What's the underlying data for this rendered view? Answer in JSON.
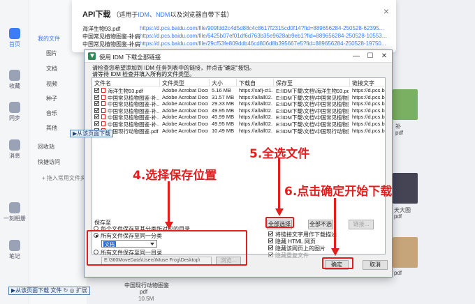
{
  "api_panel": {
    "title": "API下载",
    "subtitle_prefix": "（适用于",
    "idm": "IDM",
    "sep": "、",
    "ndm": "NDM",
    "subtitle_suffix": "以及浏览器自带下载）",
    "close": "×",
    "rows": [
      {
        "name": "海洋生物93.pdf",
        "url": "https://d.pcs.baidu.com/file/909fdd2c4d5d88c4c8617f2315cd0f14?fid=889656284-250528-62395..."
      },
      {
        "name": "中国常见植物图鉴-补病菌...",
        "url": "https://d.pcs.baidu.com/file/6425b07ef01df6d763b35e9628ab9eb1?fid=889656284-250528-10553..."
      },
      {
        "name": "中国常见植物图鉴-补病菌...",
        "url": "https://d.pcs.baidu.com/file/29cf53fe809ddb46cd806d8b395667e5?fid=889656284-250528-19750..."
      }
    ]
  },
  "bg": {
    "nav": [
      {
        "label": "首页",
        "active": true
      },
      {
        "label": "收藏"
      },
      {
        "label": "同步"
      },
      {
        "label": "消息"
      },
      {
        "label": "一刻相册"
      },
      {
        "label": "笔记"
      }
    ],
    "side_items": [
      {
        "label": "我的文件",
        "blue": true
      },
      {
        "label": "图片"
      },
      {
        "label": "文档"
      },
      {
        "label": "视频"
      },
      {
        "label": "种子"
      },
      {
        "label": "音乐"
      },
      {
        "label": "其他"
      },
      {
        "label": "回收站"
      },
      {
        "label": "快捷访问"
      },
      {
        "label": "+ 拖入常用文件夹"
      }
    ],
    "file_labels": [
      "补",
      "pdf",
      "...",
      "天大图",
      "pdf",
      "pdf"
    ],
    "bottom_file": {
      "name": "中国现行动物图鉴",
      "type": "pdf",
      "size": "10.5M"
    },
    "strip_bottom": "▶从该页面下载 文件",
    "strip_bottom_extra": "↻ ◎ 扩展",
    "strip_mid": "▶从该页面下载"
  },
  "dialog": {
    "title": "使用 IDM 下载全部链接",
    "desc_line1": "请检查您希望添加到 IDM 任务列表中的链接，并点击\"确定\"按钮。",
    "desc_line2": "请等待 IDM 检查并填入所有的文件类型。",
    "columns": [
      "文件名",
      "文件类型",
      "大小",
      "下载自",
      "保存至",
      "链接文字"
    ],
    "rows": [
      {
        "name": "海洋生物93.pdf",
        "type": "Adobe Acrobat Docu...",
        "size": "5.16 MB",
        "from": "https://xafj-ct1...",
        "save": "E:\\IDM下载\\文档\\海洋生物93.pdf",
        "link": "https://d.pcs.b..."
      },
      {
        "name": "中国常见植物图鉴-补...",
        "type": "Adobe Acrobat Docu...",
        "size": "31.57 MB",
        "from": "https://allall02...",
        "save": "E:\\IDM下载\\文档\\中国常见植物图鉴...",
        "link": "https://d.pcs.b..."
      },
      {
        "name": "中国常见植物图鉴-补...",
        "type": "Adobe Acrobat Docu...",
        "size": "29.33 MB",
        "from": "https://allall02...",
        "save": "E:\\IDM下载\\文档\\中国常见植物图鉴...",
        "link": "https://d.pcs.b..."
      },
      {
        "name": "中国常见植物图鉴-补...",
        "type": "Adobe Acrobat Docu...",
        "size": "49.95 MB",
        "from": "https://allall02...",
        "save": "E:\\IDM下载\\文档\\中国常见植物图鉴...",
        "link": "https://d.pcs.b..."
      },
      {
        "name": "中国常见植物图鉴-补...",
        "type": "Adobe Acrobat Docu...",
        "size": "45.99 MB",
        "from": "https://allall02...",
        "save": "E:\\IDM下载\\文档\\中国常见植物图鉴...",
        "link": "https://d.pcs.b..."
      },
      {
        "name": "中国常见植物图鉴-补...",
        "type": "Adobe Acrobat Docu...",
        "size": "49.95 MB",
        "from": "https://allall02...",
        "save": "E:\\IDM下载\\文档\\中国常见植物图鉴...",
        "link": "https://d.pcs.b..."
      },
      {
        "name": "中国现行动物图鉴.pdf",
        "type": "Adobe Acrobat Docu...",
        "size": "10.49 MB",
        "from": "https://allall02...",
        "save": "E:\\IDM下载\\文档\\中国现行动物图鉴...",
        "link": "https://d.pcs.b..."
      }
    ],
    "save_group_label": "保存至",
    "opt1": "每个文件保存至其分类所对应的目录",
    "opt2": "所有文件保存至同一分类",
    "category_value": "文档",
    "opt3": "所有文件保存至同一目录",
    "path_value": "E:\\360MoveData\\Users\\Muse Frog\\Desktop\\",
    "browse": "浏览...",
    "select_all": "全部选择",
    "select_none": "全部不选",
    "link_text_btn": "链接...",
    "chk1": "将链接文字用作下载描述",
    "chk2": "隐藏 HTML 网页",
    "chk3": "隐藏该网页上的图片",
    "chk4": "隐藏重复文件",
    "ok": "确定",
    "cancel": "取消"
  },
  "annotations": {
    "step4": "4.选择保存位置",
    "step5": "5.全选文件",
    "step6": "6.点击确定开始下载",
    "color": "#e21e1e"
  }
}
